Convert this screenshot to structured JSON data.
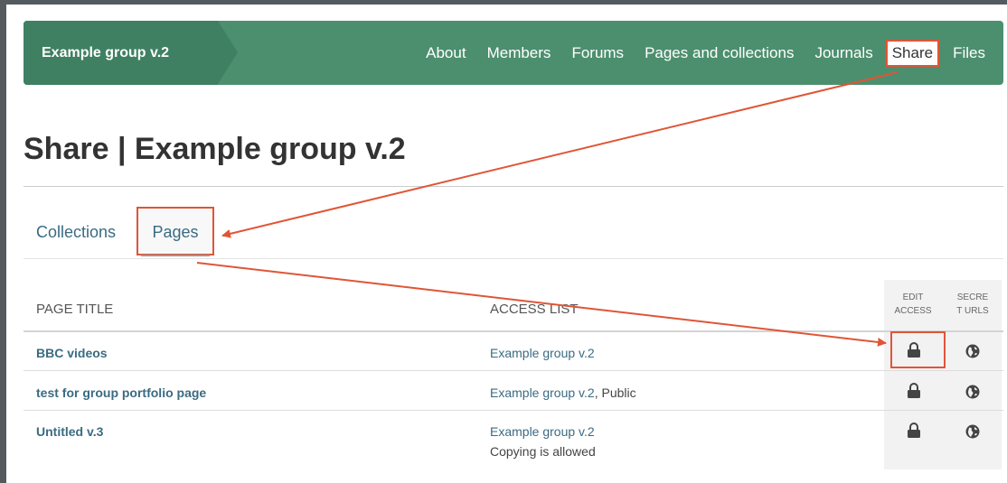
{
  "navbar": {
    "brand": "Example group v.2",
    "links": [
      "About",
      "Members",
      "Forums",
      "Pages and collections",
      "Journals"
    ],
    "active": "Share",
    "last": "Files"
  },
  "page": {
    "title": "Share | Example group v.2"
  },
  "tabs": {
    "collections": "Collections",
    "pages": "Pages"
  },
  "table": {
    "headers": {
      "page_title": "PAGE TITLE",
      "access_list": "ACCESS LIST",
      "edit_access_l1": "EDIT",
      "edit_access_l2": "ACCESS",
      "secret_urls_l1": "SECRE",
      "secret_urls_l2": "T URLS"
    },
    "rows": [
      {
        "title": "BBC videos",
        "access": "Example group v.2",
        "access_extra": "",
        "note": ""
      },
      {
        "title": "test for group portfolio page",
        "access": "Example group v.2",
        "access_extra": ", Public",
        "note": ""
      },
      {
        "title": "Untitled v.3",
        "access": "Example group v.2",
        "access_extra": "",
        "note": "Copying is allowed"
      }
    ]
  },
  "icons": {
    "edit_access": "lock-icon",
    "secret_urls": "globe-icon"
  },
  "colors": {
    "navbar": "#4c8f6e",
    "brand": "#3f8062",
    "link": "#3b6b82",
    "annotation": "#e05536"
  }
}
